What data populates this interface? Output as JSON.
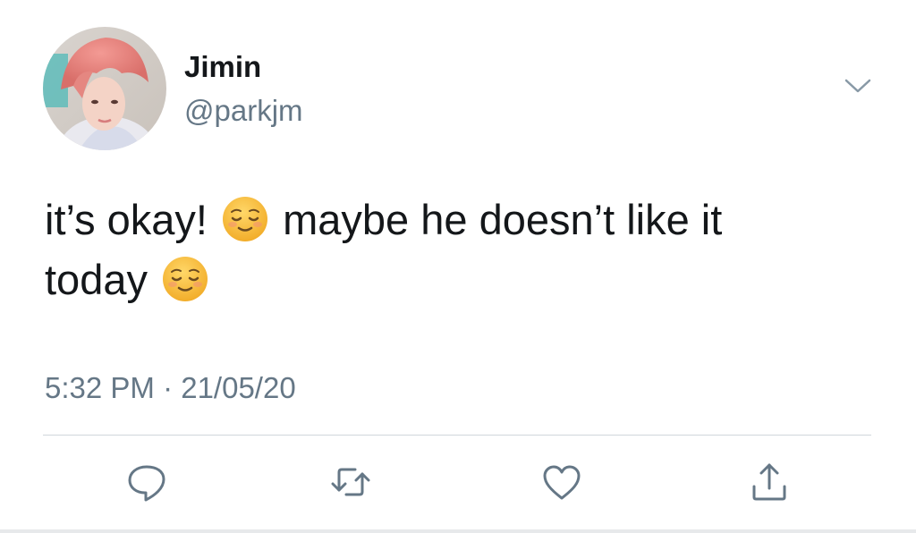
{
  "tweet": {
    "author": {
      "display_name": "Jimin",
      "handle": "@parkjm",
      "avatar_icon": "profile-photo"
    },
    "text_line1_part1": "it’s okay!",
    "text_line1_part2": "maybe he doesn’t like it",
    "text_line2": "today",
    "emoji": "relieved-face",
    "timestamp": "5:32 PM · 21/05/20",
    "menu_icon": "chevron-down-icon"
  },
  "actions": [
    {
      "icon": "reply-icon"
    },
    {
      "icon": "retweet-icon"
    },
    {
      "icon": "like-icon"
    },
    {
      "icon": "share-icon"
    }
  ],
  "colors": {
    "text_primary": "#14171a",
    "text_secondary": "#657786",
    "divider": "#d0d6db",
    "emoji_yellow": "#f9c33f"
  }
}
